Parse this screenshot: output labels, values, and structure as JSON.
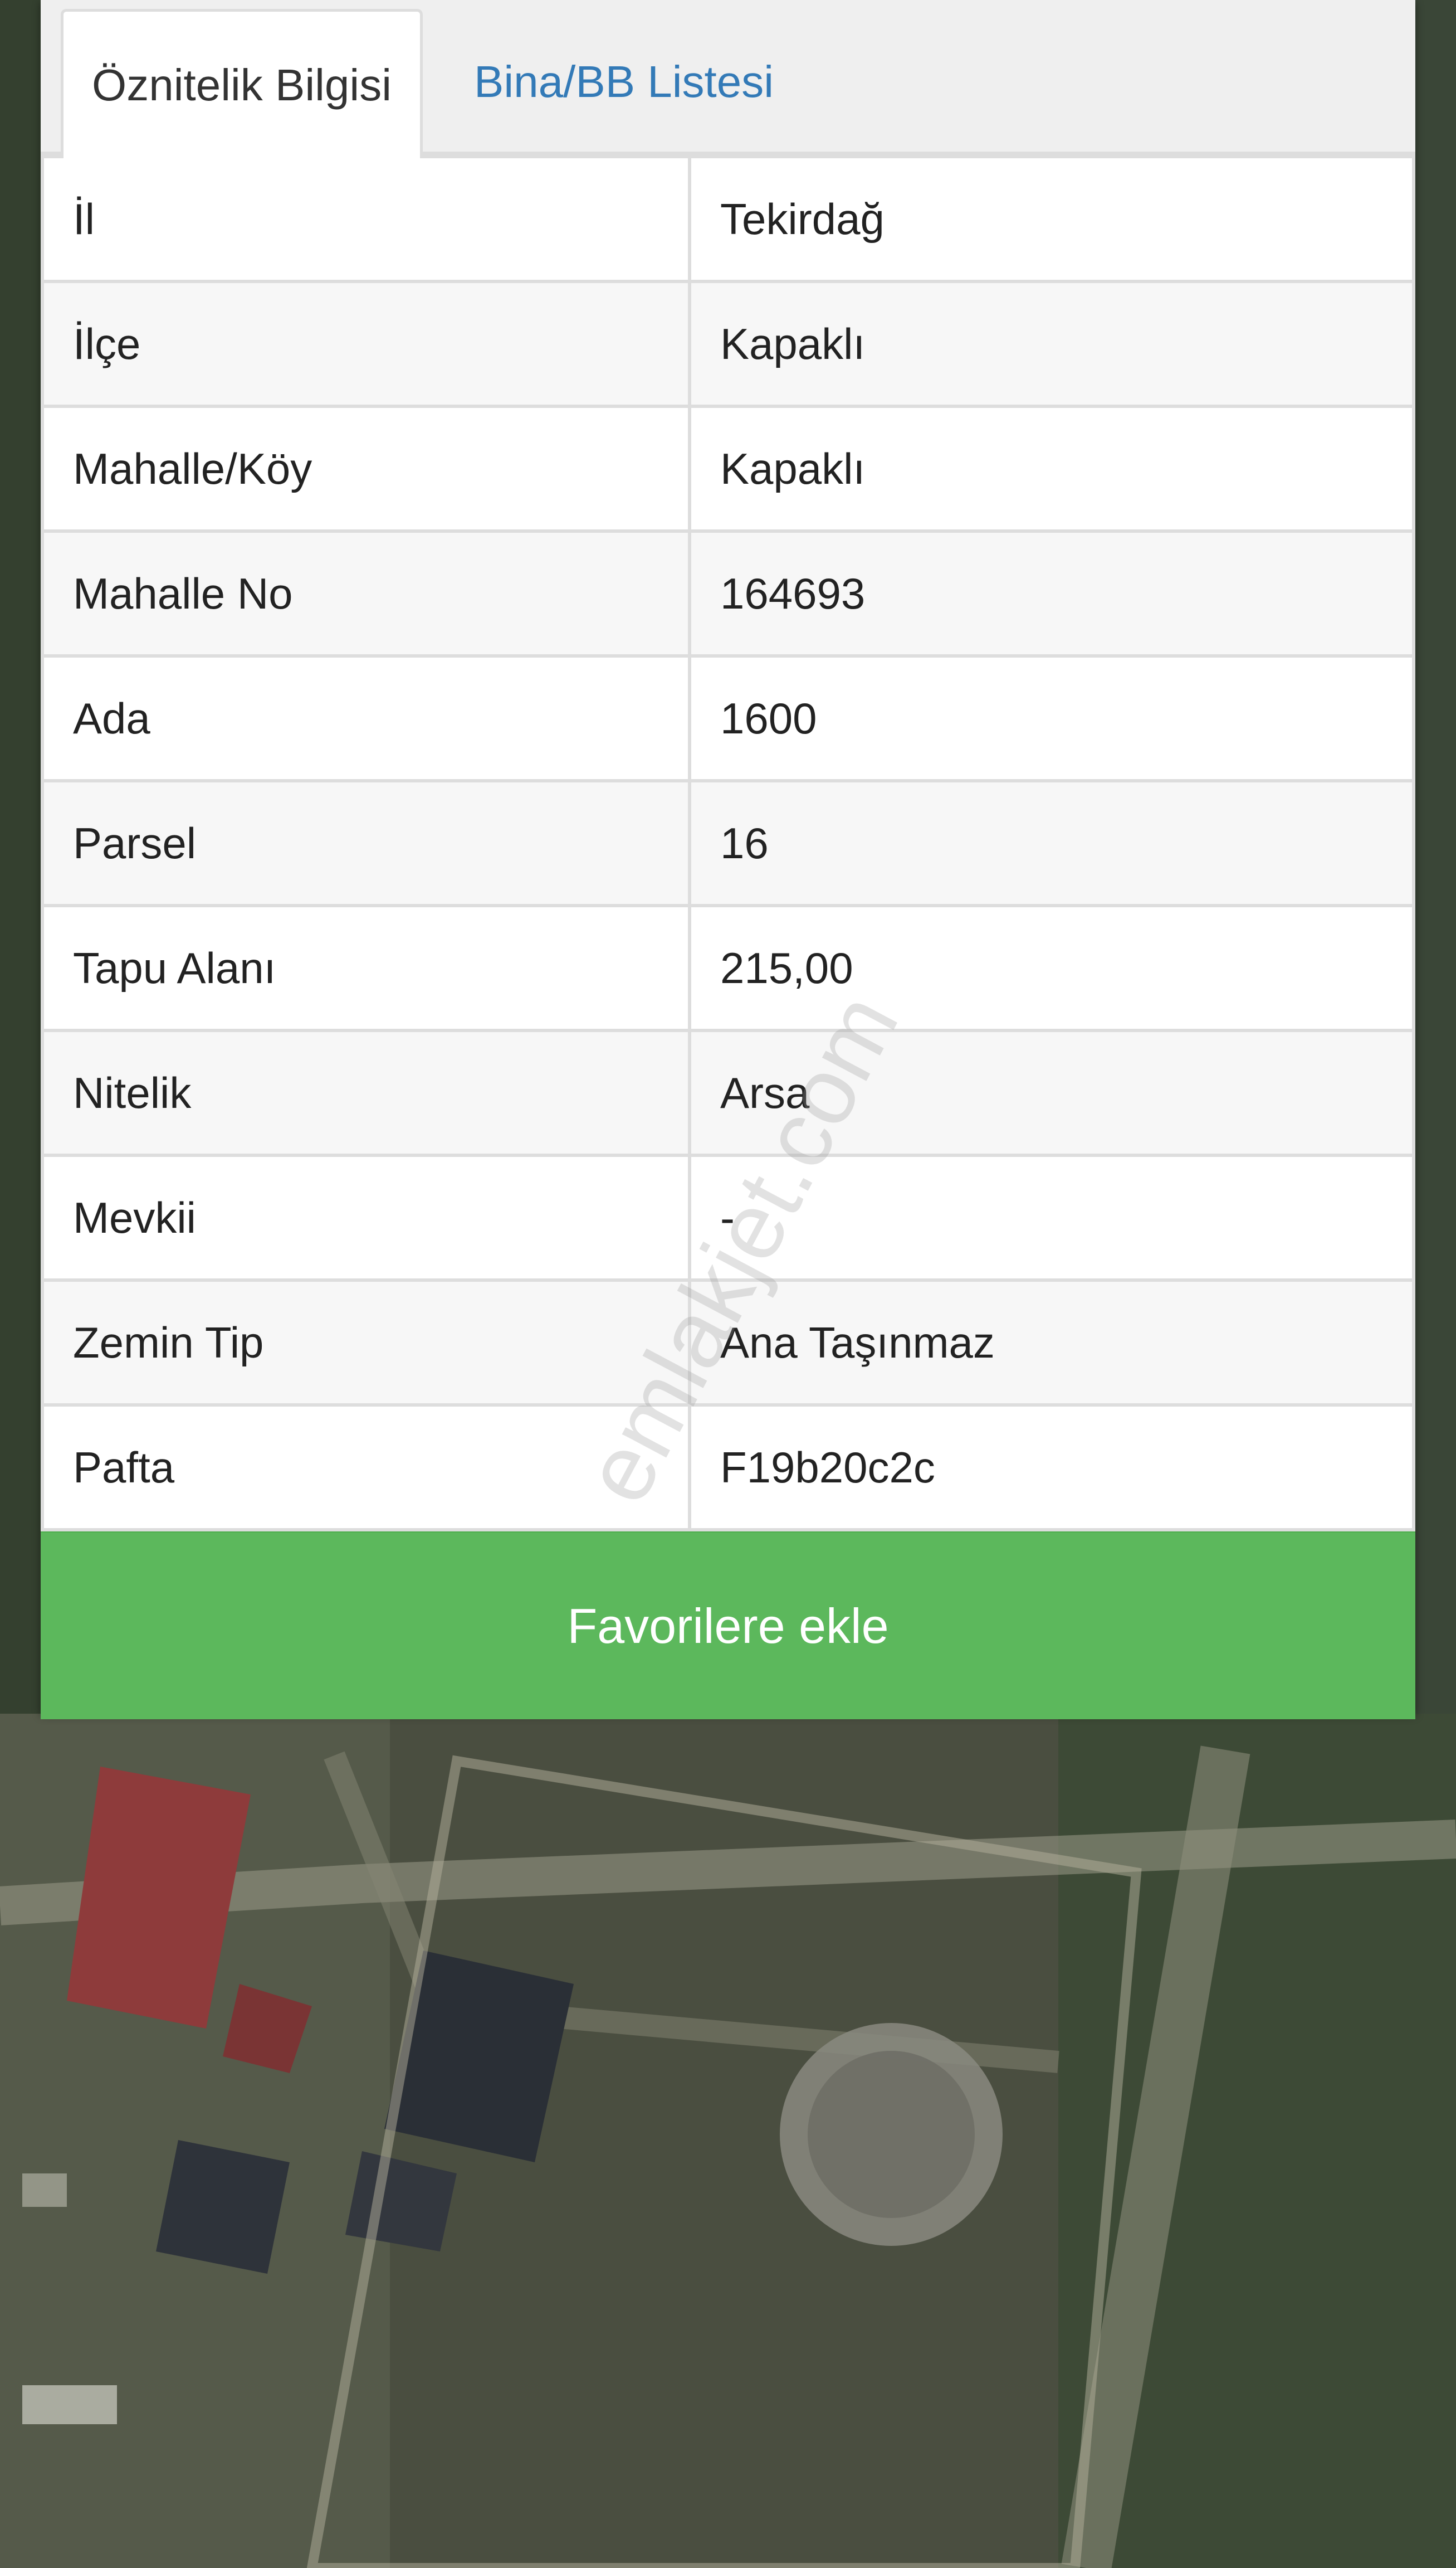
{
  "tabs": [
    {
      "label": "Öznitelik Bilgisi",
      "active": true
    },
    {
      "label": "Bina/BB Listesi",
      "active": false
    }
  ],
  "attributes": [
    {
      "label": "İl",
      "value": "Tekirdağ"
    },
    {
      "label": "İlçe",
      "value": "Kapaklı"
    },
    {
      "label": "Mahalle/Köy",
      "value": "Kapaklı"
    },
    {
      "label": "Mahalle No",
      "value": "164693"
    },
    {
      "label": "Ada",
      "value": "1600"
    },
    {
      "label": "Parsel",
      "value": "16"
    },
    {
      "label": "Tapu Alanı",
      "value": "215,00"
    },
    {
      "label": "Nitelik",
      "value": "Arsa"
    },
    {
      "label": "Mevkii",
      "value": "-"
    },
    {
      "label": "Zemin Tip",
      "value": "Ana Taşınmaz"
    },
    {
      "label": "Pafta",
      "value": "F19b20c2c"
    }
  ],
  "favorite_button": {
    "label": "Favorilere ekle"
  },
  "watermark": "emlakjet.com",
  "colors": {
    "tab_link": "#337ab7",
    "favorite_button": "#5cb85c",
    "row_alt": "#f7f7f7",
    "border": "#dddddd"
  }
}
